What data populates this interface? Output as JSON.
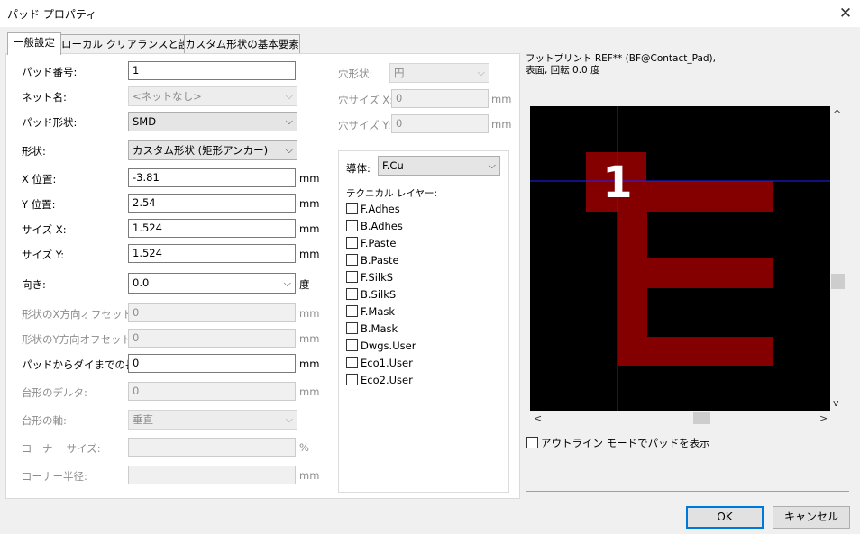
{
  "window": {
    "title": "パッド プロパティ",
    "close_glyph": "✕"
  },
  "tabs": [
    {
      "label": "一般設定"
    },
    {
      "label": "ローカル クリアランスと設定"
    },
    {
      "label": "カスタム形状の基本要素"
    }
  ],
  "form": {
    "pad_number": {
      "label": "パッド番号:",
      "value": "1"
    },
    "net_name": {
      "label": "ネット名:",
      "value": "<ネットなし>"
    },
    "pad_type": {
      "label": "パッド形状:",
      "value": "SMD"
    },
    "shape": {
      "label": "形状:",
      "value": "カスタム形状 (矩形アンカー)"
    },
    "x_pos": {
      "label": "X 位置:",
      "value": "-3.81",
      "unit": "mm"
    },
    "y_pos": {
      "label": "Y 位置:",
      "value": "2.54",
      "unit": "mm"
    },
    "size_x": {
      "label": "サイズ X:",
      "value": "1.524",
      "unit": "mm"
    },
    "size_y": {
      "label": "サイズ Y:",
      "value": "1.524",
      "unit": "mm"
    },
    "orientation": {
      "label": "向き:",
      "value": "0.0",
      "unit": "度"
    },
    "offset_x": {
      "label": "形状のX方向オフセット:",
      "value": "0",
      "unit": "mm"
    },
    "offset_y": {
      "label": "形状のY方向オフセット:",
      "value": "0",
      "unit": "mm"
    },
    "die_length": {
      "label": "パッドからダイまでの長さ:",
      "value": "0",
      "unit": "mm"
    },
    "trap_delta": {
      "label": "台形のデルタ:",
      "value": "0",
      "unit": "mm"
    },
    "trap_axis": {
      "label": "台形の軸:",
      "value": "垂直"
    },
    "corner_size": {
      "label": "コーナー サイズ:",
      "value": "",
      "unit": "%"
    },
    "corner_radius": {
      "label": "コーナー半径:",
      "value": "",
      "unit": "mm"
    }
  },
  "drill": {
    "shape": {
      "label": "穴形状:",
      "value": "円"
    },
    "size_x": {
      "label": "穴サイズ X:",
      "value": "0",
      "unit": "mm"
    },
    "size_y": {
      "label": "穴サイズ Y:",
      "value": "0",
      "unit": "mm"
    }
  },
  "layers": {
    "copper_label": "導体:",
    "copper_value": "F.Cu",
    "technical_label": "テクニカル レイヤー:",
    "items": [
      "F.Adhes",
      "B.Adhes",
      "F.Paste",
      "B.Paste",
      "F.SilkS",
      "B.SilkS",
      "F.Mask",
      "B.Mask",
      "Dwgs.User",
      "Eco1.User",
      "Eco2.User"
    ]
  },
  "preview": {
    "info_line1": "フットプリント REF** (BF@Contact_Pad),",
    "info_line2": "表面, 回転 0.0 度",
    "pad_label": "1",
    "pad_color": "#840000",
    "crosshair_color": "#2020ff",
    "background": "#000000",
    "outline_mode_label": "アウトライン モードでパッドを表示"
  },
  "buttons": {
    "ok": "OK",
    "cancel": "キャンセル"
  },
  "icons": {
    "chevron_down": "⌵",
    "scroll_up": "^",
    "scroll_down": "v",
    "scroll_left": "<",
    "scroll_right": ">"
  }
}
